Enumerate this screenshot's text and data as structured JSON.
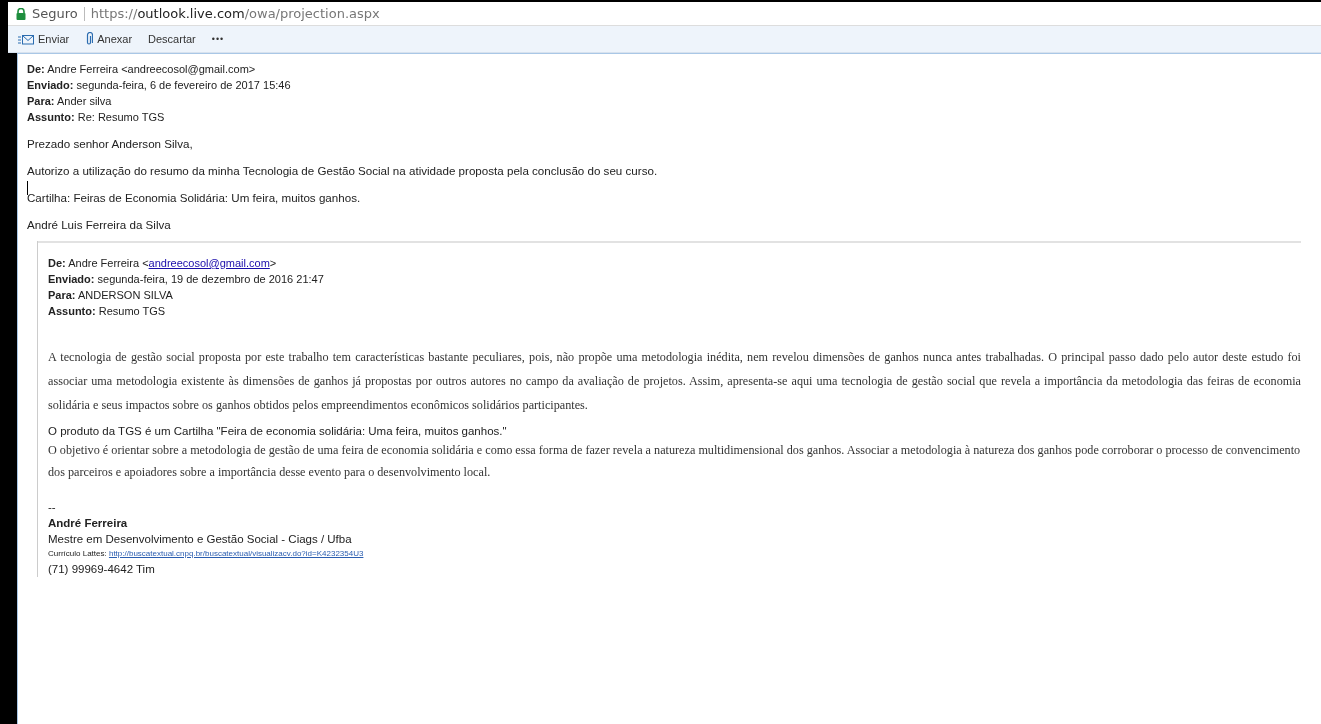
{
  "address_bar": {
    "security": "Seguro",
    "url_host_prefix": "https://",
    "url_host": "outlook.live.com",
    "url_path": "/owa/projection.aspx"
  },
  "toolbar": [
    {
      "kind": "send",
      "label": "Enviar"
    },
    {
      "kind": "attach",
      "label": "Anexar"
    },
    {
      "kind": "plain",
      "label": "Descartar"
    },
    {
      "kind": "more",
      "label": "•••"
    }
  ],
  "reply": {
    "headers": [
      {
        "label": "De:",
        "value": "Andre Ferreira <andreecosol@gmail.com>"
      },
      {
        "label": "Enviado:",
        "value": "segunda-feira, 6 de fevereiro de 2017 15:46"
      },
      {
        "label": "Para:",
        "value": "Ander silva"
      },
      {
        "label": "Assunto:",
        "value": "Re: Resumo TGS"
      }
    ],
    "paragraphs": [
      {
        "text": "Prezado senhor Anderson Silva,",
        "cursor_after": false
      },
      {
        "text": "Autorizo a utilização do resumo da minha Tecnologia de Gestão Social na atividade proposta pela conclusão do seu curso.",
        "cursor_after": true
      },
      {
        "text": "Cartilha: Feiras de Economia Solidária: Um feira, muitos ganhos.",
        "cursor_after": false
      },
      {
        "text": "André Luis Ferreira da Silva",
        "cursor_after": false
      }
    ]
  },
  "quoted": {
    "headers": [
      {
        "label": "De:",
        "value": "Andre Ferreira <",
        "link": "andreecosol@gmail.com",
        "after": ">"
      },
      {
        "label": "Enviado:",
        "value": "segunda-feira, 19 de dezembro de 2016 21:47"
      },
      {
        "label": "Para:",
        "value": "ANDERSON SILVA"
      },
      {
        "label": "Assunto:",
        "value": "Resumo TGS"
      }
    ],
    "body": "A tecnologia de gestão social proposta por este trabalho tem características bastante peculiares, pois, não propõe uma metodologia inédita, nem revelou dimensões de ganhos nunca antes trabalhadas. O principal passo dado pelo autor deste estudo foi associar uma metodologia existente às dimensões de ganhos já propostas por outros autores no campo da avaliação de projetos. Assim, apresenta-se aqui uma tecnologia de gestão social que revela a importância da metodologia das feiras de economia solidária e seus impactos sobre os ganhos obtidos pelos empreendimentos econômicos solidários participantes.",
    "product_line": "O produto da TGS é um Cartilha \"Feira de economia solidária: Uma feira, muitos ganhos.\"",
    "objective": "O objetivo é orientar sobre a metodologia de gestão de uma feira de economia solidária e como essa forma de fazer revela a natureza multidimensional dos ganhos. Associar a metodologia à natureza dos ganhos pode corroborar o processo de convencimento dos parceiros e apoiadores sobre a importância desse evento para o desenvolvimento local.",
    "signature": {
      "separator": "--",
      "name": "André Ferreira",
      "title": "Mestre em Desenvolvimento e Gestão Social - Ciags / Ufba",
      "lattes_label": "Currículo Lattes:",
      "lattes_link": "http://buscatextual.cnpq.br/buscatextual/visualizacv.do?id=K4232354U3",
      "phone": "(71) 99969-4642 Tim"
    }
  }
}
